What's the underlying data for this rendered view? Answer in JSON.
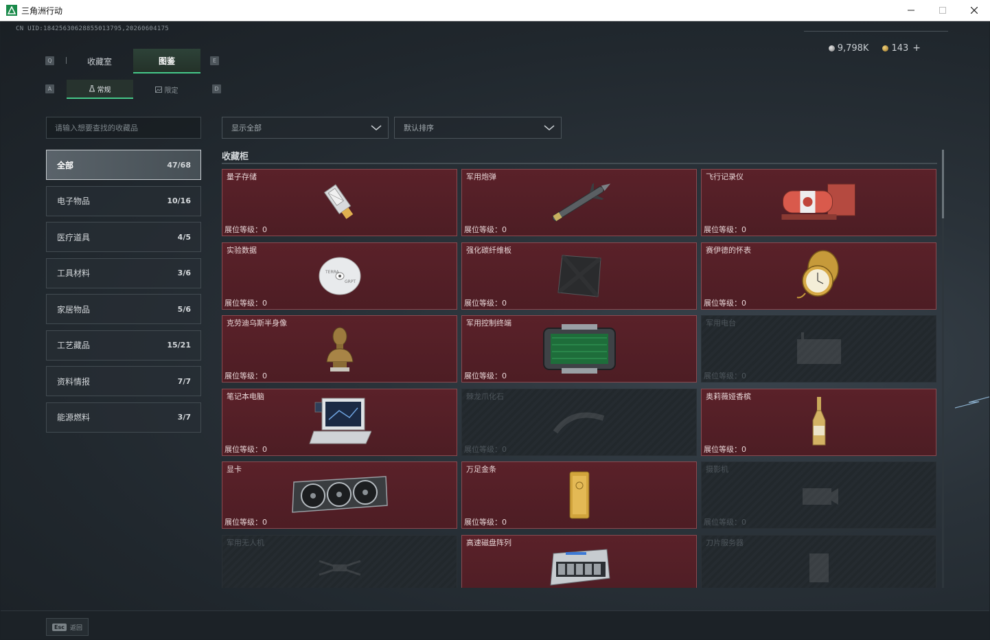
{
  "window": {
    "title": "三角洲行动"
  },
  "header": {
    "uid": "CN UID:18425630628855013795,20260604175"
  },
  "currency": {
    "silver": "9,798K",
    "gold": "143",
    "plus": "+"
  },
  "keys": {
    "tab_left": "Q",
    "tab_right": "E",
    "sub_left": "A",
    "sub_right": "D"
  },
  "tabs": [
    {
      "label": "收藏室"
    },
    {
      "label": "图鉴"
    }
  ],
  "subtabs": [
    {
      "label": "常规"
    },
    {
      "label": "限定"
    }
  ],
  "search": {
    "placeholder": "请输入想要查找的收藏品"
  },
  "categories": [
    {
      "label": "全部",
      "count": "47/68"
    },
    {
      "label": "电子物品",
      "count": "10/16"
    },
    {
      "label": "医疗道具",
      "count": "4/5"
    },
    {
      "label": "工具材料",
      "count": "3/6"
    },
    {
      "label": "家居物品",
      "count": "5/6"
    },
    {
      "label": "工艺藏品",
      "count": "15/21"
    },
    {
      "label": "资料情报",
      "count": "7/7"
    },
    {
      "label": "能源燃料",
      "count": "3/7"
    }
  ],
  "filters": {
    "show": "显示全部",
    "sort": "默认排序"
  },
  "section": {
    "title": "收藏柜"
  },
  "items": [
    {
      "name": "量子存储",
      "level": "展位等级：0",
      "icon": "usb-drive-icon",
      "locked": false
    },
    {
      "name": "军用炮弹",
      "level": "展位等级：0",
      "icon": "missile-icon",
      "locked": false
    },
    {
      "name": "飞行记录仪",
      "level": "展位等级：0",
      "icon": "flight-recorder-icon",
      "locked": false
    },
    {
      "name": "实验数据",
      "level": "展位等级：0",
      "icon": "disc-icon",
      "locked": false
    },
    {
      "name": "强化碳纤维板",
      "level": "展位等级：0",
      "icon": "carbon-plate-icon",
      "locked": false
    },
    {
      "name": "赛伊德的怀表",
      "level": "展位等级：0",
      "icon": "pocket-watch-icon",
      "locked": false
    },
    {
      "name": "克劳迪乌斯半身像",
      "level": "展位等级：0",
      "icon": "bust-icon",
      "locked": false
    },
    {
      "name": "军用控制终端",
      "level": "展位等级：0",
      "icon": "terminal-icon",
      "locked": false
    },
    {
      "name": "军用电台",
      "level": "展位等级：0",
      "icon": "radio-icon",
      "locked": true
    },
    {
      "name": "笔记本电脑",
      "level": "展位等级：0",
      "icon": "laptop-icon",
      "locked": false
    },
    {
      "name": "棘龙爪化石",
      "level": "展位等级：0",
      "icon": "fossil-icon",
      "locked": true
    },
    {
      "name": "奥莉薇娅香槟",
      "level": "展位等级：0",
      "icon": "champagne-icon",
      "locked": false
    },
    {
      "name": "显卡",
      "level": "展位等级：0",
      "icon": "gpu-icon",
      "locked": false
    },
    {
      "name": "万足金条",
      "level": "展位等级：0",
      "icon": "gold-bar-icon",
      "locked": false
    },
    {
      "name": "摄影机",
      "level": "展位等级：0",
      "icon": "camera-icon",
      "locked": true
    },
    {
      "name": "军用无人机",
      "level": "",
      "icon": "drone-icon",
      "locked": true
    },
    {
      "name": "高速磁盘阵列",
      "level": "",
      "icon": "disk-array-icon",
      "locked": false
    },
    {
      "name": "刀片服务器",
      "level": "",
      "icon": "blade-server-icon",
      "locked": true
    }
  ],
  "footer": {
    "esc_key": "Esc",
    "esc_label": "返回"
  },
  "colors": {
    "accent": "#46c98a",
    "card_bg": "#521f26",
    "card_border": "#8a4a50"
  }
}
